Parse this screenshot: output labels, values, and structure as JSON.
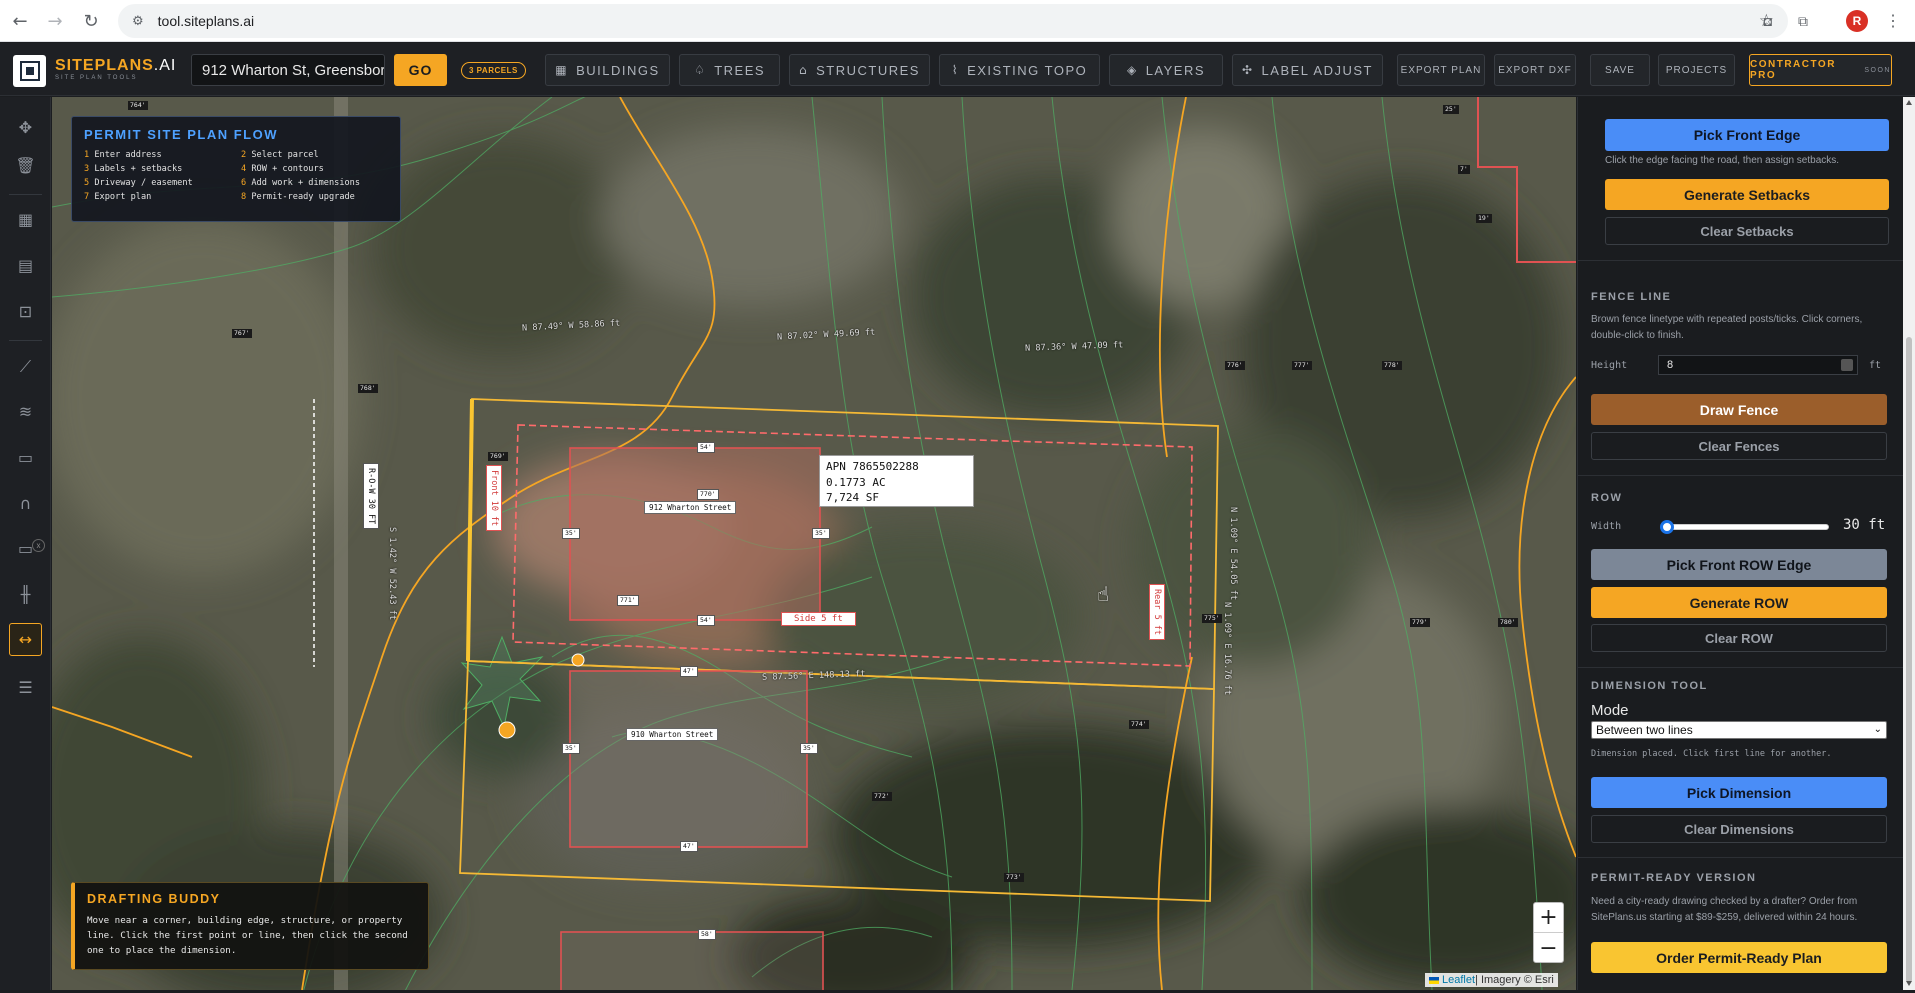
{
  "browser": {
    "url": "tool.siteplans.ai",
    "back_icon": "←",
    "forward_icon": "→",
    "reload_icon": "↻",
    "avatar_initial": "R"
  },
  "header": {
    "brand": "SITEPLANS",
    "brand_ai": ".AI",
    "brand_sub": "SITE PLAN TOOLS",
    "address_value": "912 Wharton St, Greensbor",
    "go_label": "GO",
    "parcels_badge": "3 PARCELS",
    "tools": [
      {
        "label": "BUILDINGS",
        "icon": "▦"
      },
      {
        "label": "TREES",
        "icon": "♤"
      },
      {
        "label": "STRUCTURES",
        "icon": "⌂"
      },
      {
        "label": "EXISTING TOPO",
        "icon": "⌇"
      },
      {
        "label": "LAYERS",
        "icon": "◈"
      },
      {
        "label": "LABEL ADJUST",
        "icon": "✣"
      }
    ],
    "export_plan": "EXPORT PLAN",
    "export_dxf": "EXPORT DXF",
    "save": "SAVE",
    "projects": "PROJECTS",
    "contractor_pro": "CONTRACTOR PRO",
    "soon": "SOON"
  },
  "flow": {
    "title": "PERMIT SITE PLAN FLOW",
    "steps": [
      {
        "n": "1",
        "t": "Enter address"
      },
      {
        "n": "2",
        "t": "Select parcel"
      },
      {
        "n": "3",
        "t": "Labels + setbacks"
      },
      {
        "n": "4",
        "t": "ROW + contours"
      },
      {
        "n": "5",
        "t": "Driveway / easement"
      },
      {
        "n": "6",
        "t": "Add work + dimensions"
      },
      {
        "n": "7",
        "t": "Export plan"
      },
      {
        "n": "8",
        "t": "Permit-ready upgrade"
      }
    ]
  },
  "buddy": {
    "title": "DRAFTING BUDDY",
    "text": "Move near a corner, building edge, structure, or property line. Click the first point or line, then click the second one to place the dimension."
  },
  "map": {
    "apn_line1": "APN 7865502288",
    "apn_line2": "0.1773 AC",
    "apn_line3": "7,724 SF",
    "house1": "912 Wharton Street",
    "house2": "910 Wharton Street",
    "row_label": "R-O-W 30 FT",
    "front_setback": "Front 10 ft",
    "side_setback": "Side 5 ft",
    "rear_setback": "Rear 5 ft",
    "dims": [
      "54'",
      "54'",
      "35'",
      "35'",
      "770'",
      "771'",
      "47'",
      "47'",
      "35'",
      "35'",
      "58'",
      "775'"
    ],
    "elevations": [
      "764'",
      "767'",
      "768'",
      "769'",
      "776'",
      "777'",
      "778'",
      "779'",
      "780'",
      "774'",
      "772'",
      "773'",
      "25'",
      "7'",
      "19'"
    ],
    "bearings": [
      "N 87.49° W 58.86 ft",
      "N 87.02° W 49.69 ft",
      "N 87.36° W 47.09 ft",
      "S 1.42° W 52.43 ft",
      "S 87.56° E 148.13 ft",
      "N 1.09° E 54.05 ft",
      "N 1.09° E 16.76 ft"
    ],
    "zoom_in": "+",
    "zoom_out": "−",
    "attr_leaflet": "Leaflet",
    "attr_rest": " | Imagery © Esri"
  },
  "panel": {
    "pick_front_edge": "Pick Front Edge",
    "front_edge_hint": "Click the edge facing the road, then assign setbacks.",
    "generate_setbacks": "Generate Setbacks",
    "clear_setbacks": "Clear Setbacks",
    "fence_title": "FENCE LINE",
    "fence_hint": "Brown fence linetype with repeated posts/ticks. Click corners, double-click to finish.",
    "height_label": "Height",
    "height_value": "8",
    "height_unit": "ft",
    "draw_fence": "Draw Fence",
    "clear_fences": "Clear Fences",
    "row_title": "ROW",
    "width_label": "Width",
    "row_width_value": "30 ft",
    "row_width_fraction": 0.0,
    "pick_row_edge": "Pick Front ROW Edge",
    "generate_row": "Generate ROW",
    "clear_row": "Clear ROW",
    "dim_title": "DIMENSION TOOL",
    "mode_label": "Mode",
    "mode_value": "Between two lines",
    "dim_hint": "Dimension placed. Click first line for another.",
    "pick_dimension": "Pick Dimension",
    "clear_dimensions": "Clear Dimensions",
    "permit_title": "PERMIT-READY VERSION",
    "permit_hint": "Need a city-ready drawing checked by a drafter? Order from SitePlans.us starting at $89-$259, delivered within 24 hours.",
    "order_btn": "Order Permit-Ready Plan"
  },
  "colors": {
    "accent": "#f5a623",
    "blue": "#4a8df7",
    "setback_red": "#e05252",
    "parcel_yellow": "#f5b935"
  }
}
